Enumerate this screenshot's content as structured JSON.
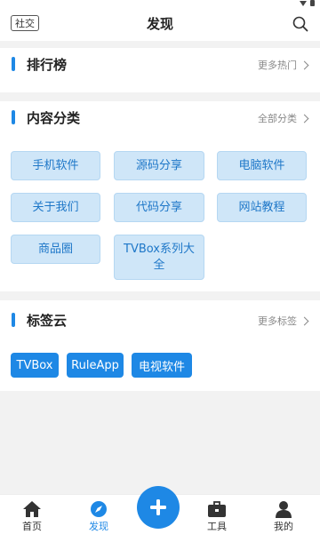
{
  "header": {
    "social_label": "社交",
    "title": "发现",
    "search_icon": "search-icon"
  },
  "ranking": {
    "title": "排行榜",
    "more_label": "更多热门"
  },
  "categories": {
    "title": "内容分类",
    "more_label": "全部分类",
    "items": [
      "手机软件",
      "源码分享",
      "电脑软件",
      "关于我们",
      "代码分享",
      "网站教程",
      "商品圈",
      "TVBox系列大全"
    ]
  },
  "tags": {
    "title": "标签云",
    "more_label": "更多标签",
    "items": [
      "TVBox",
      "RuleApp",
      "电视软件"
    ]
  },
  "nav": {
    "items": [
      {
        "label": "首页",
        "icon": "home-icon"
      },
      {
        "label": "发现",
        "icon": "compass-icon"
      },
      {
        "label": "工具",
        "icon": "toolbox-icon"
      },
      {
        "label": "我的",
        "icon": "user-icon"
      }
    ],
    "fab_icon": "plus-icon",
    "active": "发现"
  },
  "colors": {
    "accent": "#1e88e5",
    "category_bg": "#cfe6f8",
    "category_text": "#1e77c8",
    "page_bg": "#f2f2f2"
  }
}
